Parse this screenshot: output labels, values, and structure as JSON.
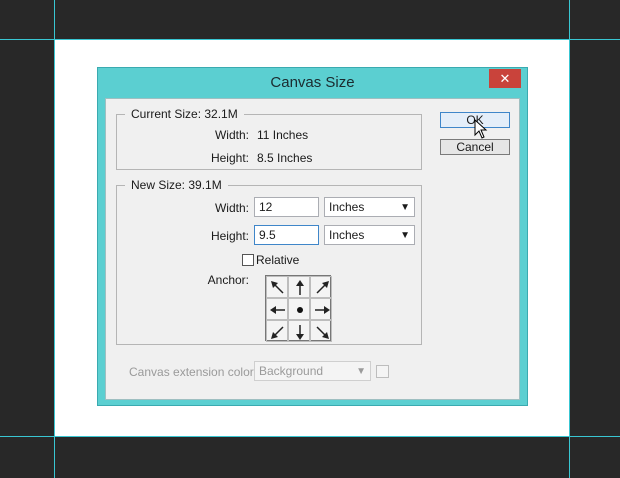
{
  "dialog": {
    "title": "Canvas Size",
    "close_glyph": "✕",
    "current_size": {
      "legend": "Current Size: 32.1M",
      "width_label": "Width:",
      "width_value": "11 Inches",
      "height_label": "Height:",
      "height_value": "8.5 Inches"
    },
    "new_size": {
      "legend": "New Size: 39.1M",
      "width_label": "Width:",
      "width_value": "12",
      "width_unit": "Inches",
      "height_label": "Height:",
      "height_value": "9.5",
      "height_unit": "Inches",
      "relative_label": "Relative",
      "relative_checked": false,
      "anchor_label": "Anchor:",
      "anchor_selected": "center"
    },
    "extension": {
      "label": "Canvas extension color:",
      "value": "Background",
      "enabled": false
    },
    "buttons": {
      "ok": "OK",
      "cancel": "Cancel"
    }
  },
  "colors": {
    "dialog_frame": "#5bcfd1",
    "guide": "#39c6d2",
    "workspace": "#282828",
    "close_button": "#c9433b"
  },
  "icons": [
    "close-icon",
    "chevron-down-icon",
    "anchor-arrow-icon",
    "anchor-center-dot-icon",
    "mouse-cursor-icon"
  ]
}
